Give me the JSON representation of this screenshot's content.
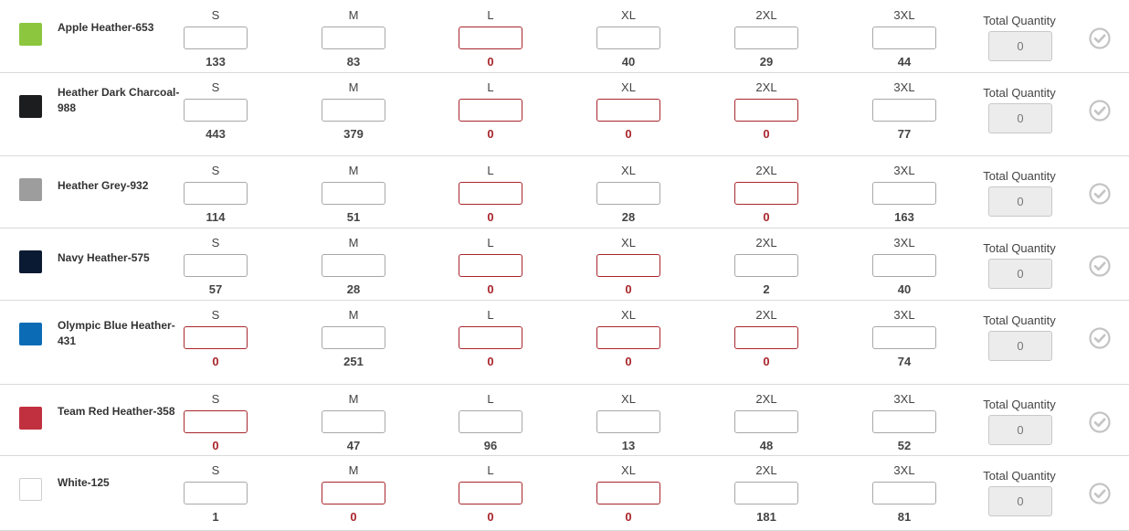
{
  "size_labels": [
    "S",
    "M",
    "L",
    "XL",
    "2XL",
    "3XL"
  ],
  "total_quantity_label": "Total Quantity",
  "colors": {
    "in_stock_text": "#444444",
    "out_of_stock_text": "#a8262c",
    "out_of_stock_border": "#a8262c"
  },
  "rows": [
    {
      "name": "Apple Heather-653",
      "swatch": "#8cc63f",
      "stock": [
        "133",
        "83",
        "0",
        "40",
        "29",
        "44"
      ],
      "total": "0"
    },
    {
      "name": "Heather Dark Charcoal-988",
      "swatch": "#1c1d1f",
      "stock": [
        "443",
        "379",
        "0",
        "0",
        "0",
        "77"
      ],
      "total": "0"
    },
    {
      "name": "Heather Grey-932",
      "swatch": "#9d9d9d",
      "stock": [
        "114",
        "51",
        "0",
        "28",
        "0",
        "163"
      ],
      "total": "0"
    },
    {
      "name": "Navy Heather-575",
      "swatch": "#0a1a33",
      "stock": [
        "57",
        "28",
        "0",
        "0",
        "2",
        "40"
      ],
      "total": "0"
    },
    {
      "name": "Olympic Blue Heather-431",
      "swatch": "#0b6cb5",
      "stock": [
        "0",
        "251",
        "0",
        "0",
        "0",
        "74"
      ],
      "total": "0"
    },
    {
      "name": "Team Red Heather-358",
      "swatch": "#c1303f",
      "stock": [
        "0",
        "47",
        "96",
        "13",
        "48",
        "52"
      ],
      "total": "0"
    },
    {
      "name": "White-125",
      "swatch": "#ffffff",
      "stock": [
        "1",
        "0",
        "0",
        "0",
        "181",
        "81"
      ],
      "total": "0"
    }
  ]
}
